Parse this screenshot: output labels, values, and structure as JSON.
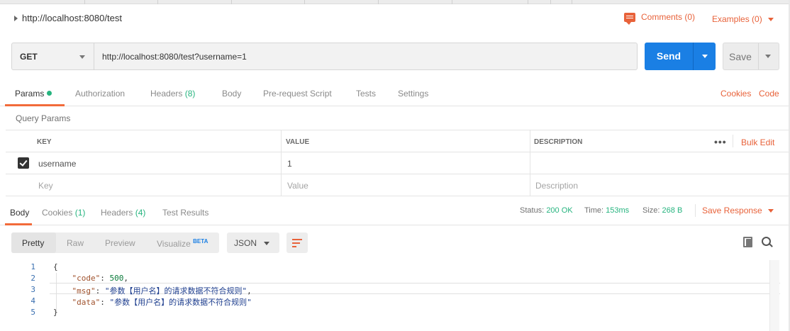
{
  "request": {
    "title": "http://localhost:8080/test",
    "comments_label": "Comments (0)",
    "examples_label": "Examples (0)",
    "method": "GET",
    "url": "http://localhost:8080/test?username=1",
    "send_label": "Send",
    "save_label": "Save"
  },
  "request_tabs": {
    "params": "Params",
    "authorization": "Authorization",
    "headers_label": "Headers",
    "headers_count": "(8)",
    "body": "Body",
    "prerequest": "Pre-request Script",
    "tests": "Tests",
    "settings": "Settings",
    "cookies_link": "Cookies",
    "code_link": "Code"
  },
  "query_params": {
    "title": "Query Params",
    "columns": {
      "key": "KEY",
      "value": "VALUE",
      "description": "DESCRIPTION"
    },
    "bulk_edit": "Bulk Edit",
    "more": "•••",
    "rows": [
      {
        "checked": true,
        "key": "username",
        "value": "1",
        "description": ""
      }
    ],
    "placeholder": {
      "key": "Key",
      "value": "Value",
      "description": "Description"
    }
  },
  "response_tabs": {
    "body": "Body",
    "cookies_label": "Cookies",
    "cookies_count": "(1)",
    "headers_label": "Headers",
    "headers_count": "(4)",
    "test_results": "Test Results"
  },
  "response_status": {
    "status_label": "Status:",
    "status_value": "200 OK",
    "time_label": "Time:",
    "time_value": "153ms",
    "size_label": "Size:",
    "size_value": "268 B",
    "save_response": "Save Response"
  },
  "response_toolbar": {
    "pretty": "Pretty",
    "raw": "Raw",
    "preview": "Preview",
    "visualize": "Visualize",
    "beta": "BETA",
    "format": "JSON"
  },
  "response_body": {
    "line_numbers": [
      "1",
      "2",
      "3",
      "4",
      "5"
    ],
    "open_brace": "{",
    "close_brace": "}",
    "code_key": "\"code\"",
    "code_value": "500",
    "msg_key": "\"msg\"",
    "msg_value": "\"参数【用户名】的请求数据不符合规则\"",
    "data_key": "\"data\"",
    "data_value": "\"参数【用户名】的请求数据不符合规则\""
  },
  "colors": {
    "accent_orange": "#e8623a",
    "send_blue": "#1a7fe4",
    "status_green": "#26b47f"
  }
}
